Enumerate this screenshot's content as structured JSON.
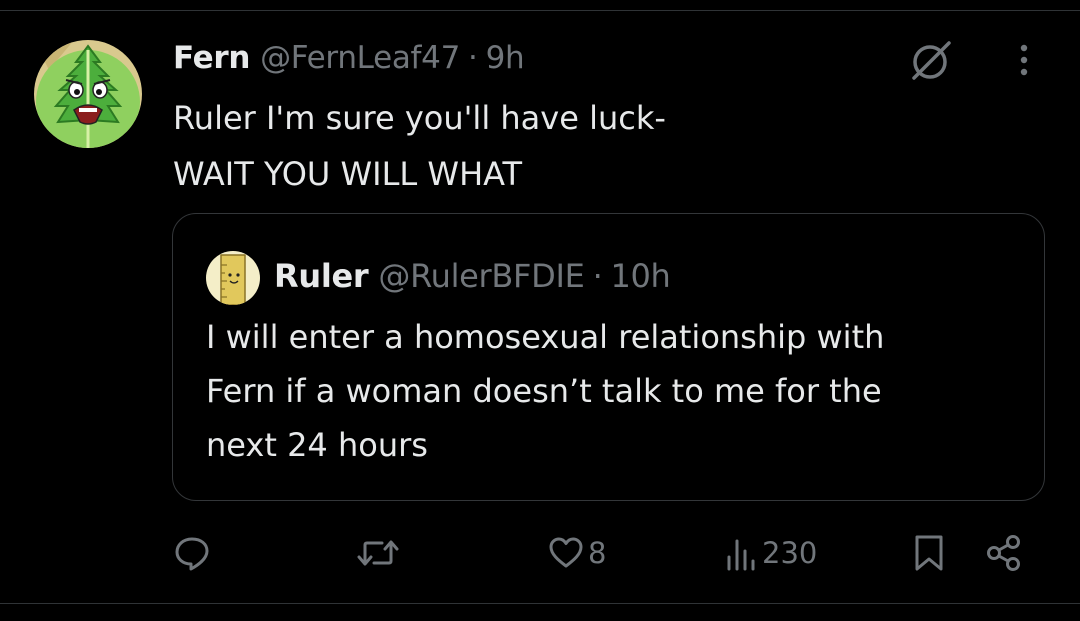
{
  "post": {
    "author_name": "Fern",
    "author_handle": "@FernLeaf47",
    "separator": "·",
    "time": "9h",
    "text_lines": [
      "Ruler I'm sure you'll have luck-",
      "WAIT YOU WILL WHAT"
    ],
    "avatar_icon": "fern-avatar-icon",
    "header_icons": [
      "grok-icon",
      "more-icon"
    ]
  },
  "quoted_post": {
    "author_name": "Ruler",
    "author_handle": "@RulerBFDIE",
    "separator": "·",
    "time": "10h",
    "text_lines": [
      "I will enter a homosexual relationship with",
      "Fern if a woman doesn’t talk to me for the",
      "next 24 hours"
    ],
    "avatar_icon": "ruler-avatar-icon"
  },
  "actions": {
    "reply": {
      "icon": "reply-icon",
      "count": ""
    },
    "repost": {
      "icon": "repost-icon",
      "count": ""
    },
    "like": {
      "icon": "heart-icon",
      "count": "8"
    },
    "views": {
      "icon": "views-icon",
      "count": "230"
    },
    "bookmark": {
      "icon": "bookmark-icon"
    },
    "share": {
      "icon": "share-icon"
    }
  },
  "colors": {
    "background": "#000000",
    "text_primary": "#e7e9ea",
    "text_secondary": "#71767b",
    "border": "#333639",
    "fern_green": "#5fbf4a",
    "ruler_yellow": "#e8d27a"
  }
}
